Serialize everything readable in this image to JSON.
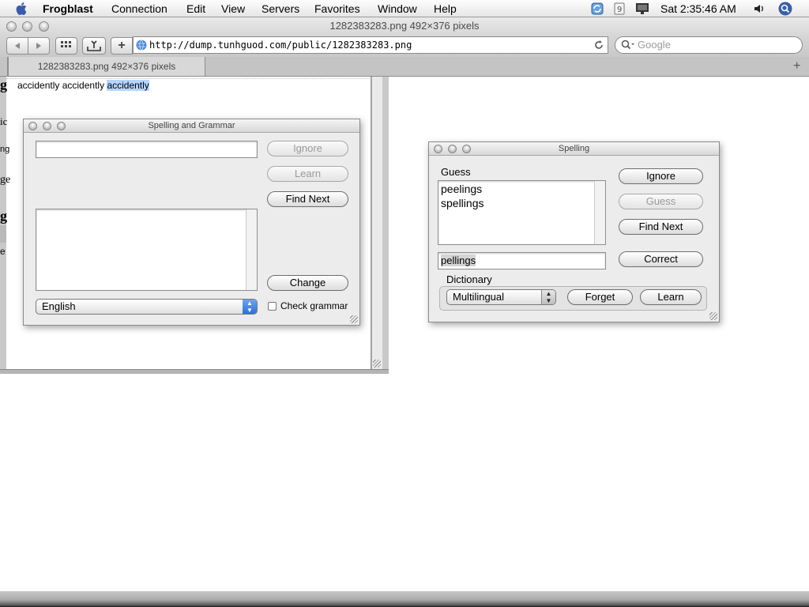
{
  "menubar": {
    "app_name": "Frogblast",
    "items": [
      "Connection",
      "Edit",
      "View",
      "Servers",
      "Favorites",
      "Window",
      "Help"
    ],
    "clock": "Sat 2:35:46 AM"
  },
  "window": {
    "title": "1282383283.png 492×376 pixels",
    "url": "http://dump.tunhguod.com/public/1282383283.png",
    "search_placeholder": "Google",
    "tab_label": "1282383283.png 492×376 pixels",
    "new_tab_label": "+"
  },
  "screenshot": {
    "words": [
      "accidently",
      "accidently"
    ],
    "highlighted_word": "accidently",
    "edge_glyphs": [
      "g",
      "ic",
      "ng",
      "ge",
      "g",
      "e"
    ]
  },
  "spelling_grammar": {
    "title": "Spelling and Grammar",
    "ignore": "Ignore",
    "learn": "Learn",
    "find_next": "Find Next",
    "change": "Change",
    "language": "English",
    "check_grammar": "Check grammar"
  },
  "spelling": {
    "title": "Spelling",
    "guess_label": "Guess",
    "guesses": [
      "peelings",
      "spellings"
    ],
    "word": "pellings",
    "ignore": "Ignore",
    "guess": "Guess",
    "find_next": "Find Next",
    "correct": "Correct",
    "dictionary_label": "Dictionary",
    "dictionary": "Multilingual",
    "forget": "Forget",
    "learn": "Learn"
  }
}
